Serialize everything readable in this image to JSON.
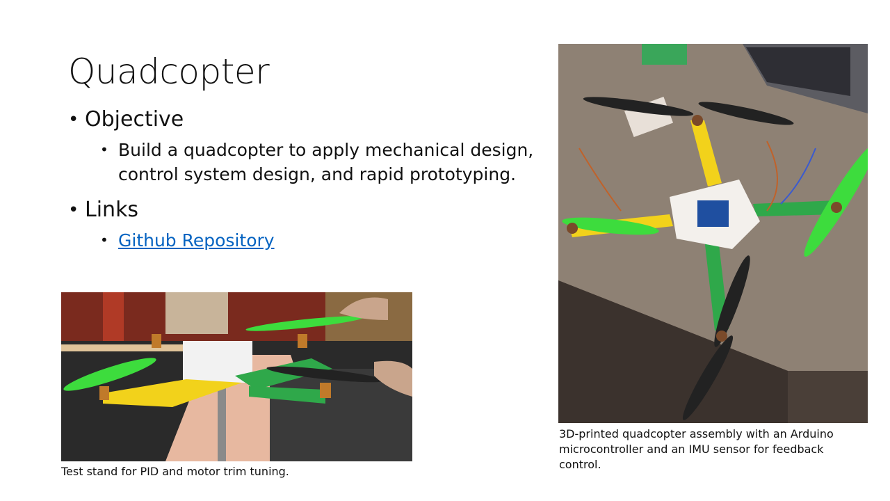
{
  "slide": {
    "title": "Quadcopter",
    "bullets": [
      {
        "label": "Objective",
        "sub": [
          "Build a quadcopter to apply mechanical design, control system design, and rapid prototyping."
        ]
      },
      {
        "label": "Links",
        "sub_link": "Github Repository"
      }
    ],
    "captions": {
      "left_photo": "Test stand for PID and motor trim tuning.",
      "right_photo": "3D-printed quadcopter assembly with an Arduino microcontroller and an IMU sensor for feedback control."
    },
    "colors": {
      "link": "#0563c1",
      "propeller": "#3ddc3d",
      "frame_yellow": "#f2d21b",
      "frame_green": "#2fa84a"
    }
  }
}
